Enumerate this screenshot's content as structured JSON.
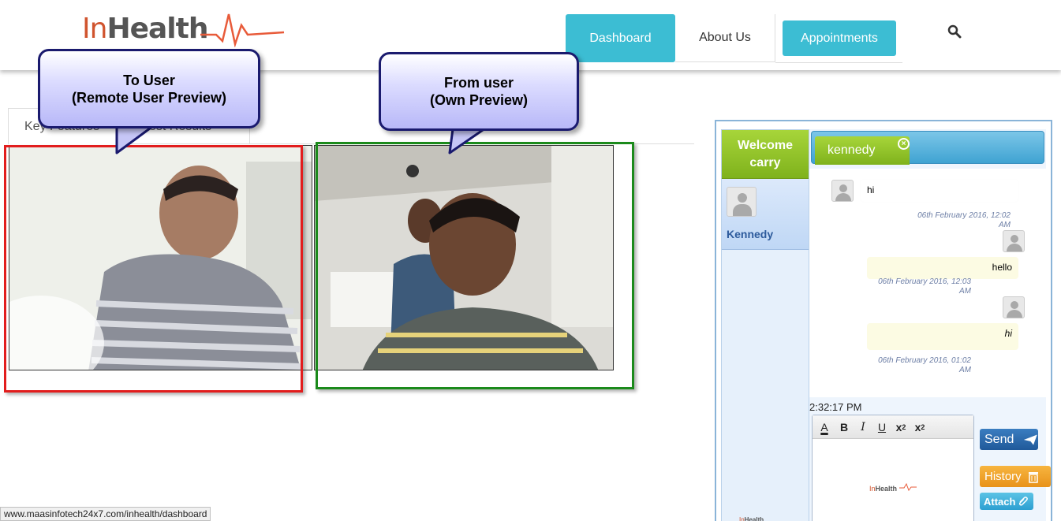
{
  "header": {
    "logo_in": "In",
    "logo_health": "Health",
    "nav": {
      "dashboard": "Dashboard",
      "about": "About Us",
      "appointments": "Appointments"
    },
    "search_icon": "search-icon"
  },
  "tabs": {
    "key_features": "Key Features",
    "test_results": "Test Results"
  },
  "callouts": {
    "remote_line1": "To User",
    "remote_line2": "(Remote User Preview)",
    "own_line1": "From user",
    "own_line2": "(Own Preview)"
  },
  "status_bar": {
    "url": "www.maasinfotech24x7.com/inhealth/dashboard"
  },
  "chat": {
    "welcome_line1": "Welcome",
    "welcome_line2": "carry",
    "contacts": [
      {
        "name": "Kennedy"
      }
    ],
    "active_tab": "kennedy",
    "messages": [
      {
        "text": "hi",
        "time_line1": "06th February 2016, 12:02",
        "time_line2": "AM",
        "direction": "in"
      },
      {
        "text": "hello",
        "time_line1": "06th February 2016, 12:03",
        "time_line2": "AM",
        "direction": "out"
      },
      {
        "text": "hi",
        "time_line1": "06th February 2016, 01:02",
        "time_line2": "AM",
        "direction": "out"
      }
    ],
    "clock": "2:32:17 PM",
    "toolbar": {
      "font_color": "A",
      "bold": "B",
      "italic": "I",
      "underline": "U",
      "subscript": "x",
      "subscript_sub": "2",
      "superscript": "x",
      "superscript_sup": "2"
    },
    "buttons": {
      "send": "Send",
      "history": "History",
      "attach": "Attach"
    },
    "small_logo_in": "In",
    "small_logo_health": "Health"
  },
  "colors": {
    "accent": "#3cbdd3",
    "green": "#7fb21c",
    "red_frame": "#e21d1d",
    "green_frame": "#1b8a1b"
  }
}
